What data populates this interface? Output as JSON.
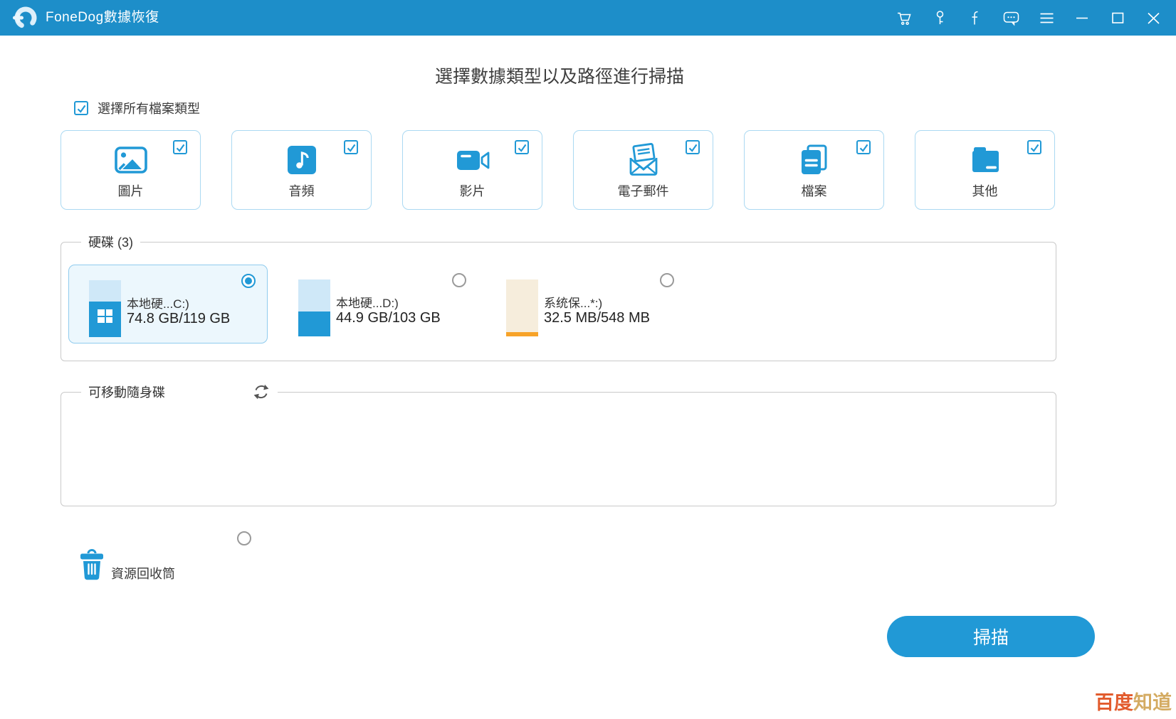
{
  "titlebar": {
    "app_title": "FoneDog數據恢復",
    "bg_color": "#1d8ec9",
    "icons": [
      "cart-icon",
      "key-icon",
      "facebook-icon",
      "chat-icon",
      "menu-icon",
      "minimize-icon",
      "maximize-icon",
      "close-icon"
    ]
  },
  "header": {
    "title": "選擇數據類型以及路徑進行掃描"
  },
  "select_all": {
    "label": "選擇所有檔案類型",
    "checked": true
  },
  "file_types": [
    {
      "label": "圖片",
      "icon": "image-icon",
      "checked": true
    },
    {
      "label": "音頻",
      "icon": "audio-icon",
      "checked": true
    },
    {
      "label": "影片",
      "icon": "video-icon",
      "checked": true
    },
    {
      "label": "電子郵件",
      "icon": "email-icon",
      "checked": true
    },
    {
      "label": "檔案",
      "icon": "document-icon",
      "checked": true
    },
    {
      "label": "其他",
      "icon": "folder-icon",
      "checked": true
    }
  ],
  "hard_disk_section": {
    "legend": "硬碟 (3)",
    "drives": [
      {
        "name": "本地硬...C:)",
        "size": "74.8 GB/119 GB",
        "selected": true,
        "used_percent": 63,
        "style": "blue",
        "windows_logo": true
      },
      {
        "name": "本地硬...D:)",
        "size": "44.9 GB/103 GB",
        "selected": false,
        "used_percent": 44,
        "style": "blue",
        "windows_logo": false
      },
      {
        "name": "系统保...*:)",
        "size": "32.5 MB/548 MB",
        "selected": false,
        "used_percent": 8,
        "style": "orange",
        "windows_logo": false
      }
    ]
  },
  "removable_section": {
    "legend": "可移動隨身碟",
    "refresh_icon": "refresh-icon",
    "items": []
  },
  "recycle_bin": {
    "label": "資源回收筒",
    "selected": false,
    "icon": "trash-icon"
  },
  "scan_button": {
    "label": "掃描"
  },
  "watermark": {
    "part1": "百度",
    "part2": "知道"
  },
  "colors": {
    "accent": "#2199d6",
    "titlebar": "#1d8ec9",
    "selected_card_bg": "#ecf7fd",
    "beige_disk": "#f6eddc",
    "orange_fill": "#f7a329",
    "watermark_red": "#e25b2d",
    "watermark_gold": "#d4ab62"
  }
}
